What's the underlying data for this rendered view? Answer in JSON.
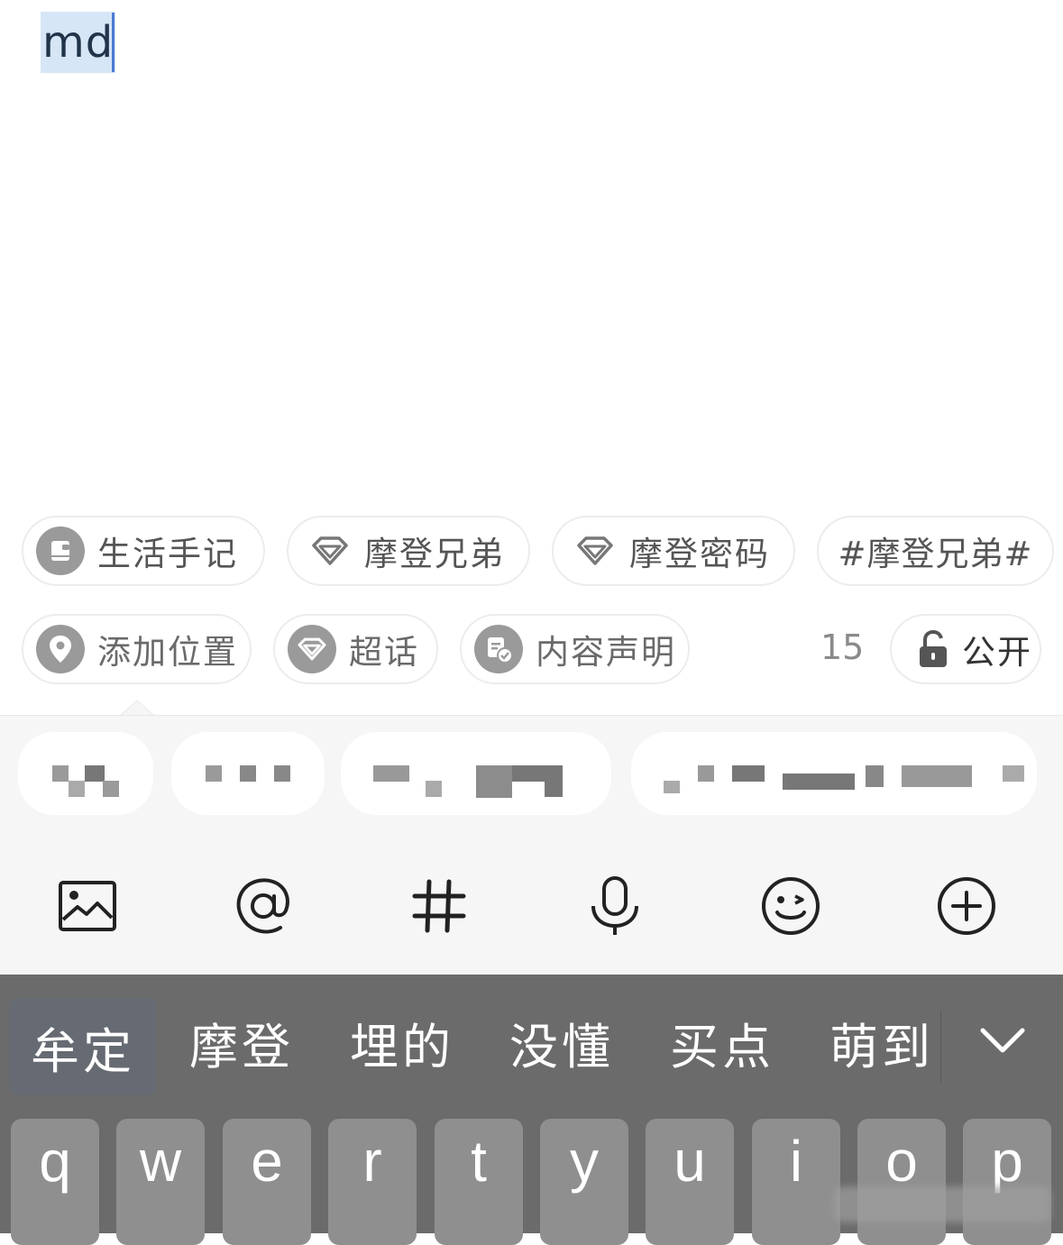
{
  "editor": {
    "composing_text": "md"
  },
  "tags": [
    {
      "label": "生活手记",
      "icon": "notebook-icon"
    },
    {
      "label": "摩登兄弟",
      "icon": "diamond-icon"
    },
    {
      "label": "摩登密码",
      "icon": "diamond-icon"
    },
    {
      "label": "#摩登兄弟#",
      "icon": ""
    }
  ],
  "options": {
    "location": {
      "label": "添加位置",
      "icon": "location-pin-icon"
    },
    "super_topic": {
      "label": "超话",
      "icon": "diamond-icon"
    },
    "content_statement": {
      "label": "内容声明",
      "icon": "content-statement-icon"
    },
    "count": "15",
    "visibility": {
      "label": "公开",
      "icon": "unlock-icon"
    }
  },
  "toolbar": [
    "image-icon",
    "at-icon",
    "hashtag-icon",
    "microphone-icon",
    "emoji-icon",
    "plus-icon"
  ],
  "keyboard": {
    "candidates": [
      "牟定",
      "摩登",
      "埋的",
      "没懂",
      "买点",
      "萌到"
    ],
    "keys": [
      "q",
      "w",
      "e",
      "r",
      "t",
      "y",
      "u",
      "i",
      "o",
      "p"
    ]
  },
  "colors": {
    "keyboard_bg": "#6b6b6b",
    "key_bg": "#8f8f8f",
    "selection": "#d6e6f7"
  }
}
